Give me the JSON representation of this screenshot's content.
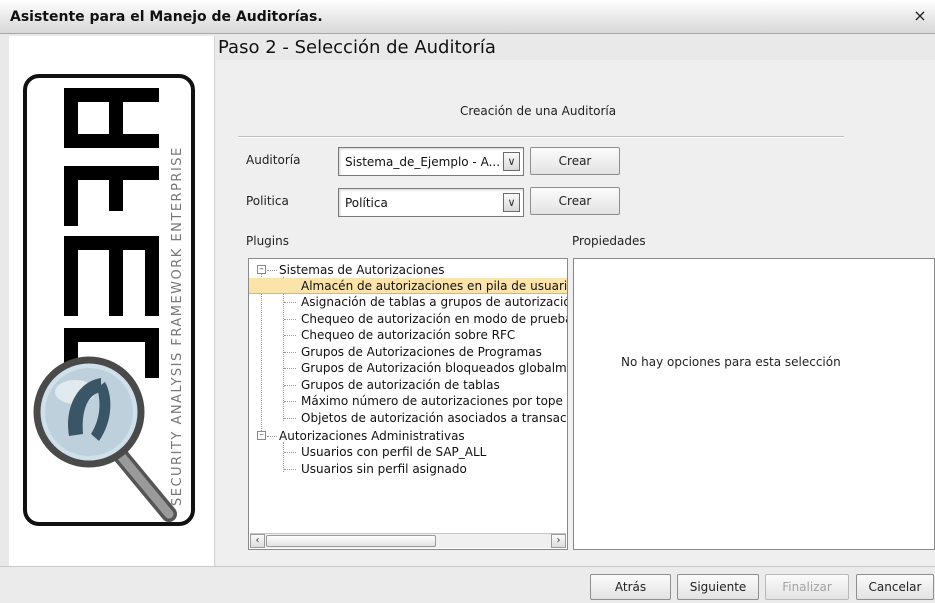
{
  "window": {
    "title": "Asistente para el Manejo de Auditorías.",
    "close_glyph": "×"
  },
  "logo": {
    "letters": "SAFE",
    "tagline": "SECURITY ANALYSIS FRAMEWORK ENTERPRISE"
  },
  "step": {
    "title": "Paso 2 - Selección de Auditoría",
    "subtitle": "Creación de una Auditoría"
  },
  "form": {
    "auditoria": {
      "label": "Auditoría",
      "value": "Sistema_de_Ejemplo - A...",
      "create_label": "Crear"
    },
    "politica": {
      "label": "Politica",
      "value": "Política",
      "create_label": "Crear"
    }
  },
  "plugins": {
    "label": "Plugins",
    "tree": [
      {
        "label": "Sistemas de Autorizaciones",
        "level": 0,
        "expanded": true
      },
      {
        "label": "Almacén de autorizaciones en pila de usuario",
        "level": 1,
        "selected": true
      },
      {
        "label": "Asignación de tablas a grupos de autorización",
        "level": 1
      },
      {
        "label": "Chequeo de autorización en modo de prueba",
        "level": 1
      },
      {
        "label": "Chequeo de autorización sobre RFC",
        "level": 1
      },
      {
        "label": "Grupos de Autorizaciones de Programas",
        "level": 1
      },
      {
        "label": "Grupos de Autorización bloqueados globalment",
        "level": 1
      },
      {
        "label": "Grupos de autorización de tablas",
        "level": 1
      },
      {
        "label": "Máximo número de autorizaciones por tope de",
        "level": 1
      },
      {
        "label": "Objetos de autorización asociados a transaccio",
        "level": 1
      },
      {
        "label": "Autorizaciones Administrativas",
        "level": 0,
        "expanded": true
      },
      {
        "label": "Usuarios con perfil de SAP_ALL",
        "level": 1
      },
      {
        "label": "Usuarios sin perfil asignado",
        "level": 1
      }
    ]
  },
  "properties": {
    "label": "Propiedades",
    "empty_message": "No hay opciones para esta selección"
  },
  "buttons": {
    "back": "Atrás",
    "next": "Siguiente",
    "finish": "Finalizar",
    "cancel": "Cancelar"
  },
  "icons": {
    "dropdown": "chevron-down-icon",
    "scroll_left": "chevron-left-icon",
    "scroll_right": "chevron-right-icon",
    "magnifier": "magnifier-icon"
  }
}
